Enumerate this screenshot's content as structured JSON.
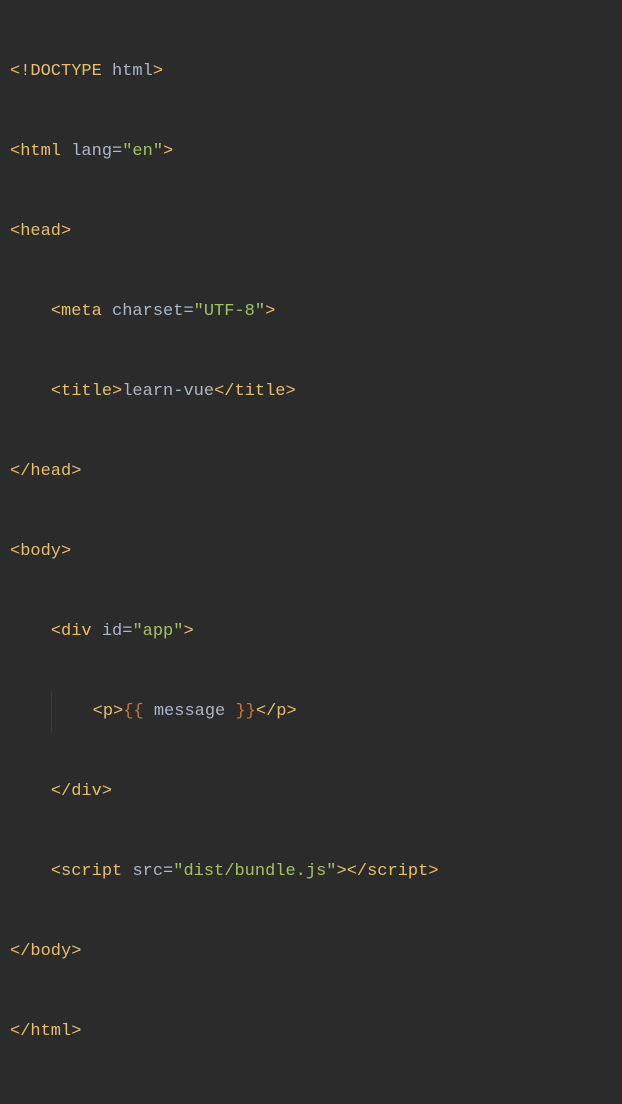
{
  "code": {
    "doctype_open": "<!",
    "doctype_kw": "DOCTYPE",
    "doctype_sp": " ",
    "doctype_id": "html",
    "doctype_close": ">",
    "html_open_lt": "<",
    "html_tag": "html",
    "html_sp": " ",
    "html_attr": "lang",
    "html_eq": "=",
    "html_val": "\"en\"",
    "html_gt": ">",
    "head_open_lt": "<",
    "head_tag": "head",
    "head_gt": ">",
    "meta_lt": "<",
    "meta_tag": "meta",
    "meta_sp": " ",
    "meta_attr": "charset",
    "meta_eq": "=",
    "meta_val": "\"UTF-8\"",
    "meta_gt": ">",
    "title_open_lt": "<",
    "title_tag": "title",
    "title_open_gt": ">",
    "title_text": "learn-vue",
    "title_close_lt": "</",
    "title_close_gt": ">",
    "head_close_lt": "</",
    "head_close_gt": ">",
    "body_open_lt": "<",
    "body_tag": "body",
    "body_gt": ">",
    "div_open_lt": "<",
    "div_tag": "div",
    "div_sp": " ",
    "div_attr": "id",
    "div_eq": "=",
    "div_val": "\"app\"",
    "div_gt": ">",
    "p_open_lt": "<",
    "p_tag": "p",
    "p_open_gt": ">",
    "mustache_open": "{{ ",
    "mustache_var": "message",
    "mustache_close": " }}",
    "p_close_lt": "</",
    "p_close_gt": ">",
    "div_close_lt": "</",
    "div_close_gt": ">",
    "script_open_lt": "<",
    "script_tag": "script",
    "script_sp": " ",
    "script_attr": "src",
    "script_eq": "=",
    "script_val": "\"dist/bundle.js\"",
    "script_open_gt": ">",
    "script_close_lt": "</",
    "script_close_gt": ">",
    "body_close_lt": "</",
    "body_close_gt": ">",
    "html_close_lt": "</",
    "html_close_gt": ">"
  }
}
